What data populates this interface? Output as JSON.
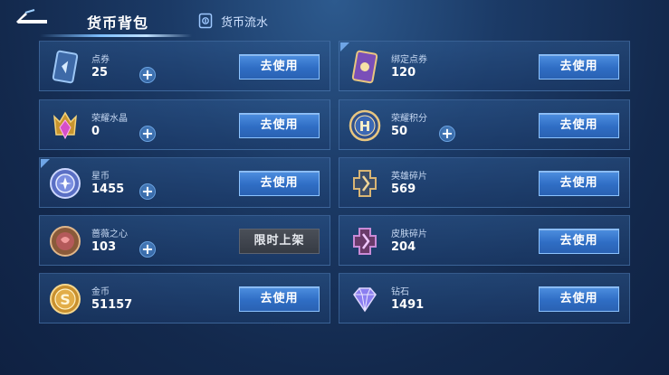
{
  "header": {
    "title": "货币背包",
    "flow_tab_label": "货币流水",
    "back_icon": "back-arrow-icon",
    "flow_icon": "ledger-icon"
  },
  "action_label": "去使用",
  "limited_label": "限时上架",
  "colors": {
    "accent": "#3d7fd6",
    "button_border": "#8cc3ff",
    "limited_button": "#3f444d",
    "background": "#1b3a66"
  },
  "left_items": [
    {
      "name": "点券",
      "count": "25",
      "icon": "coupon-card-icon",
      "has_plus": true,
      "action": "use"
    },
    {
      "name": "荣耀水晶",
      "count": "0",
      "icon": "glory-crystal-icon",
      "has_plus": true,
      "action": "use"
    },
    {
      "name": "星币",
      "count": "1455",
      "icon": "star-coin-icon",
      "has_plus": true,
      "action": "use"
    },
    {
      "name": "蔷薇之心",
      "count": "103",
      "icon": "rose-heart-icon",
      "has_plus": true,
      "action": "limited"
    },
    {
      "name": "金币",
      "count": "51157",
      "icon": "gold-coin-icon",
      "has_plus": false,
      "action": "use"
    }
  ],
  "right_items": [
    {
      "name": "绑定点券",
      "count": "120",
      "icon": "bound-coupon-icon",
      "has_plus": false,
      "action": "use"
    },
    {
      "name": "荣耀积分",
      "count": "50",
      "icon": "glory-points-icon",
      "has_plus": true,
      "action": "use"
    },
    {
      "name": "英雄碎片",
      "count": "569",
      "icon": "hero-shard-icon",
      "has_plus": false,
      "action": "use"
    },
    {
      "name": "皮肤碎片",
      "count": "204",
      "icon": "skin-shard-icon",
      "has_plus": false,
      "action": "use"
    },
    {
      "name": "钻石",
      "count": "1491",
      "icon": "diamond-icon",
      "has_plus": false,
      "action": "use"
    }
  ]
}
